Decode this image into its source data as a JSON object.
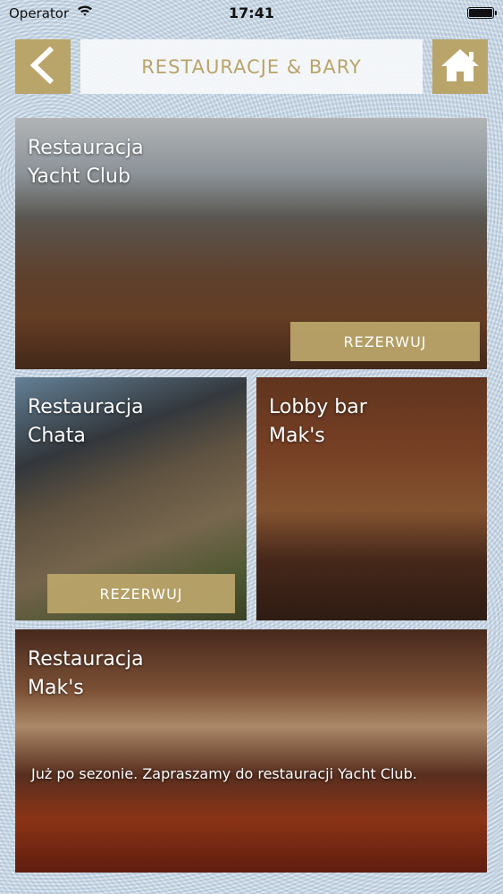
{
  "status_bar": {
    "carrier": "Operator",
    "time": "17:41"
  },
  "header": {
    "title": "RESTAURACJE & BARY"
  },
  "cards": [
    {
      "title": "Restauracja\nYacht Club",
      "button_label": "REZERWUJ"
    },
    {
      "title": "Restauracja\nChata",
      "button_label": "REZERWUJ"
    },
    {
      "title": "Lobby bar\nMak's"
    },
    {
      "title": "Restauracja\nMak's",
      "note": "Już po sezonie. Zapraszamy do restauracji Yacht Club."
    }
  ],
  "colors": {
    "accent": "#b9a469",
    "title_bg": "#f6f8fa"
  },
  "icons": {
    "back": "chevron-left-icon",
    "home": "home-icon",
    "wifi": "wifi-icon",
    "battery": "battery-icon"
  }
}
